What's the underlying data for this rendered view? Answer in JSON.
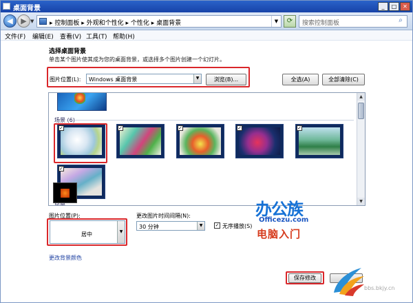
{
  "window": {
    "title": "桌面背景"
  },
  "window_controls": {
    "min": "_",
    "max": "□",
    "close": "✕"
  },
  "address": {
    "breadcrumb": "▸ 控制面板 ▸ 外观和个性化 ▸ 个性化 ▸ 桌面背景",
    "search_placeholder": "搜索控制面板"
  },
  "menu": [
    "文件(F)",
    "编辑(E)",
    "查看(V)",
    "工具(T)",
    "帮助(H)"
  ],
  "content": {
    "heading": "选择桌面背景",
    "description": "单击某个图片使其成为您的桌面背景，或选择多个图片创建一个幻灯片。",
    "location_label": "图片位置(L):",
    "location_value": "Windows 桌面背景",
    "browse_label": "浏览(B)...",
    "select_all_label": "全选(A)",
    "clear_all_label": "全部清除(C)",
    "group_scenes": "场景 (6)",
    "group_landscape": "风景",
    "position_label": "图片位置(P):",
    "position_value": "居中",
    "interval_label": "更改图片时间间隔(N):",
    "interval_value": "30 分钟",
    "shuffle_label": "无序播放(S)",
    "change_color_link": "更改背景颜色",
    "save_label": "保存修改"
  },
  "watermark": {
    "line1": "办公族",
    "line2": "Officezu.com",
    "line3": "电脑入门",
    "line4": "bbs.bkjy.cn"
  }
}
